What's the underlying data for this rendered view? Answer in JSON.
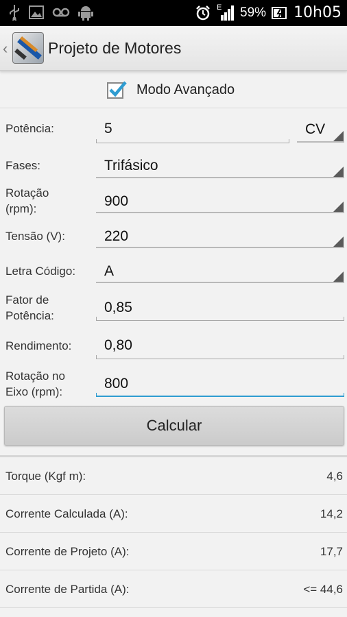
{
  "status_bar": {
    "battery_percent": "59%",
    "time": "10h05",
    "signal_label": "E",
    "icons": [
      "usb-icon",
      "image-icon",
      "voicemail-icon",
      "android-icon",
      "alarm-clock-icon",
      "signal-icon",
      "battery-charging-icon"
    ]
  },
  "action_bar": {
    "title": "Projeto de Motores",
    "up_caret": "‹"
  },
  "advanced_mode": {
    "label": "Modo Avançado",
    "checked": true
  },
  "form": {
    "potencia": {
      "label": "Potência:",
      "value": "5",
      "unit": "CV"
    },
    "fases": {
      "label": "Fases:",
      "value": "Trifásico"
    },
    "rotacao": {
      "label": "Rotação\n(rpm):",
      "value": "900"
    },
    "tensao": {
      "label": "Tensão (V):",
      "value": "220"
    },
    "letra": {
      "label": "Letra Código:",
      "value": "A"
    },
    "fator": {
      "label": "Fator de\nPotência:",
      "value": "0,85"
    },
    "rendimento": {
      "label": "Rendimento:",
      "value": "0,80"
    },
    "rotacao_eixo": {
      "label": "Rotação no\nEixo (rpm):",
      "value": "800"
    }
  },
  "calculate_button": "Calcular",
  "results": [
    {
      "label": "Torque (Kgf m):",
      "value": "4,6"
    },
    {
      "label": "Corrente Calculada (A):",
      "value": "14,2"
    },
    {
      "label": "Corrente de Projeto (A):",
      "value": "17,7"
    },
    {
      "label": "Corrente de Partida (A):",
      "value": "<= 44,6"
    }
  ],
  "colors": {
    "accent": "#2e9cd1",
    "status_bar_bg": "#000000",
    "background": "#f2f2f2"
  }
}
